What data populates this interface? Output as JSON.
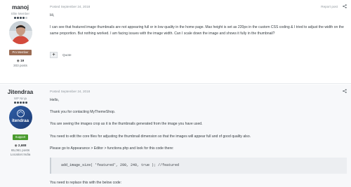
{
  "posts": [
    {
      "author": {
        "name": "manoj",
        "title": "Elite Member",
        "pips_filled": 4,
        "pips_total": 5,
        "badge": "Pro Member",
        "reputation": "19",
        "posts": "303 posts"
      },
      "date": "Posted September 24, 2018",
      "report": "Report post",
      "paragraphs": [
        "Hi,",
        "I can see that featured image thumbnails are not appearing full or in low quality in the home page. Max height is set as 220px in the custom CSS coding & I tried to adjust the width on the same proportion. But nothing worked. I am facing issues with the image width. Can I scale down the image and shows it fully in the thumbnail?"
      ],
      "quote_label": "Quote"
    },
    {
      "author": {
        "name": "Jitendraa",
        "title": "WP Ninja",
        "pips_filled": 5,
        "pips_total": 5,
        "avatar_text": "itendraa",
        "badge": "Support",
        "reputation": "2,688",
        "posts": "65,061 posts",
        "location": "Location:India"
      },
      "date": "Posted September 24, 2018",
      "paragraphs": [
        "Hello,",
        "Thank you for contacting MyThemeShop.",
        "You are seeing the images crop as it is the thumbnails generated from the image you have used.",
        "You need to edit the core files for adjusting the thumbnail dimension so that the images will appear full and of good quality also.",
        "Please go to Appearance > Editor > functions.php and look for this code there:"
      ],
      "code": "add_image_size( 'featured', 290, 240, true ); //featured",
      "after_code": "You need to replace this with the below code:"
    }
  ],
  "colors": {
    "pro_badge": "#9b6b52",
    "support_badge": "#4a9b2e",
    "pip": "#3c4650"
  },
  "icons": {
    "share": "share-icon",
    "reputation": "reputation-icon",
    "plus": "plus-icon"
  }
}
